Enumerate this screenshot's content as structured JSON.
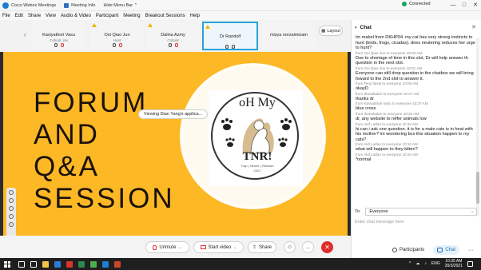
{
  "titlebar": {
    "app_title": "Cisco Webex Meetings",
    "meeting_info": "Meeting Info",
    "hide_menu": "Hide Menu Bar",
    "connection_status": "Connected",
    "minimize": "—",
    "maximize": "□",
    "close": "✕"
  },
  "menu": {
    "items": [
      "File",
      "Edit",
      "Share",
      "View",
      "Audio & Video",
      "Participant",
      "Meeting",
      "Breakout Sessions",
      "Help"
    ]
  },
  "participants": [
    {
      "name": "Kaviyathori Vasu",
      "role": "Cohost, me",
      "warn": false
    },
    {
      "name": "Ooi Qiao Jun",
      "role": "Host",
      "warn": true
    },
    {
      "name": "Dalina Azmy",
      "role": "Cohost",
      "warn": true
    },
    {
      "name": "Dr Randolf",
      "role": "",
      "warn": true,
      "active": true
    },
    {
      "name": "misya norzaimizam",
      "role": "",
      "warn": false
    }
  ],
  "layout_button": "Layout",
  "share": {
    "viewing_text": "Viewing Dian Yang's applica...",
    "slide_title": "FORUM\nAND\nQ&A\nSESSION",
    "logo_top": "oH My",
    "logo_main": "TNR!",
    "logo_sub": "Trap | Neuter | Release",
    "logo_year": "2021"
  },
  "controls": {
    "unmute": "Unmute",
    "start_video": "Start video",
    "share": "Share",
    "caret": "⌄",
    "emoji": "☺",
    "more": "…",
    "end": "✕"
  },
  "chat": {
    "title": "Chat",
    "close": "✕",
    "messages": [
      {
        "text": "Im mabel from DKHP04. my cat has very strong instincts to hunt (birds, frogs, cicadas). does neutering reduces her urge to hunt?",
        "meta": ""
      },
      {
        "text": "",
        "meta": "from Ooi Qiao Jun to everyone    10:00 AM"
      },
      {
        "text": "Due to shortage of time in this slot, Dr will help answer th question in the next slot.",
        "meta": ""
      },
      {
        "text": "",
        "meta": "from Ooi Qiao Jun to everyone    10:01 AM"
      },
      {
        "text": "Everyone can still drop question in the chatbox we will bring foward to the 2nd slot to answer it.",
        "meta": ""
      },
      {
        "text": "",
        "meta": "from Teoy faisal to everyone    10:08 AM"
      },
      {
        "text": "okayD",
        "meta": ""
      },
      {
        "text": "",
        "meta": "from thanabalan to everyone    10:27 AM"
      },
      {
        "text": "thanks dr",
        "meta": ""
      },
      {
        "text": "",
        "meta": "from Kaviyathori Vasu to everyone    10:27 AM"
      },
      {
        "text": "blue cross",
        "meta": ""
      },
      {
        "text": "",
        "meta": "from thanabalan to everyone    10:32 AM"
      },
      {
        "text": "dr, any website to reffer animals low",
        "meta": ""
      },
      {
        "text": "",
        "meta": "from Akif Lutfan to everyone    10:33 AM"
      },
      {
        "text": "hi can i ask one question. it is for a male cats is in heat with his mother? im wondering bcs this situation happen to my cats?",
        "meta": ""
      },
      {
        "text": "",
        "meta": "from Akif Lutfan to everyone    10:34 AM"
      },
      {
        "text": "what will happen to they kitten?",
        "meta": ""
      },
      {
        "text": "",
        "meta": "from Akif Lutfan to everyone    10:34 AM"
      },
      {
        "text": "*normal",
        "meta": ""
      }
    ],
    "to_label": "To:",
    "to_value": "Everyone",
    "input_placeholder": "Enter chat message here",
    "tab_participants": "Participants",
    "tab_chat": "Chat",
    "tab_more": "···"
  },
  "taskbar": {
    "lang": "ENG",
    "time": "10:35 AM",
    "date": "20/3/2021",
    "tray_icons": [
      "^",
      "☁",
      "♪",
      "✉"
    ]
  },
  "colors": {
    "slide_bg": "#fdb825",
    "active_tile": "#2aa2d8",
    "end_call": "#e02b2b",
    "connected": "#1aa260"
  }
}
